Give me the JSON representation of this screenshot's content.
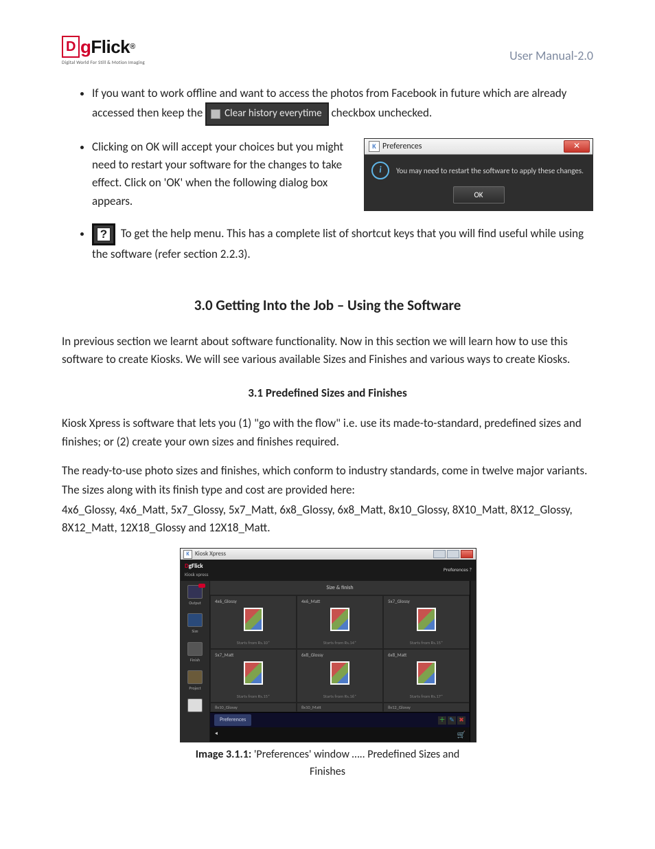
{
  "header": {
    "logo_sub": "Digital World For Still & Motion Imaging",
    "doc_title": "User Manual-2.0"
  },
  "bullets": {
    "b1_pre": "If you want to work offline and want to access the photos from Facebook in future which are already accessed then keep the ",
    "b1_chip": "Clear history everytime",
    "b1_post": " checkbox unchecked.",
    "b2": "Clicking on OK will accept your choices but you might need to restart your software for the changes to take effect. Click on 'OK' when the following dialog box appears.",
    "b3": " To get the help menu. This has a complete list of shortcut keys that you will find useful while using the software (refer section 2.2.3)."
  },
  "dialog": {
    "title": "Preferences",
    "message": "You may need to restart the software to apply these changes.",
    "ok": "OK"
  },
  "section_title": "3.0 Getting Into the Job – Using the Software",
  "intro": "In previous section we learnt about software functionality. Now in this section we will learn how to use this software to create Kiosks. We will see various available Sizes and Finishes and various ways to create Kiosks.",
  "subsection_title": "3.1 Predefined Sizes and Finishes",
  "p1": "Kiosk Xpress is software that lets you (1) \"go with the flow\" i.e. use its made-to-standard, predefined sizes and finishes; or (2) create your own sizes and finishes required.",
  "p2": "The ready-to-use photo sizes and finishes, which conform to industry standards, come in twelve major variants.",
  "p3": "The sizes along with its finish type and cost are provided here:",
  "p4": "4x6_Glossy, 4x6_Matt, 5x7_Glossy, 5x7_Matt, 6x8_Glossy, 6x8_Matt, 8x10_Glossy, 8X10_Matt, 8X12_Glossy, 8X12_Matt, 12X18_Glossy and 12X18_Matt.",
  "sw": {
    "win_title": "Kiosk Xpress",
    "brand_sub": "Kiosk xpress",
    "top_right": "Preferences  ?",
    "board_title": "Size & finish",
    "side": [
      "Output",
      "Size",
      "Finish",
      "Project",
      ""
    ],
    "cells": [
      {
        "name": "4x6_Glossy",
        "price": "Starts from Rs.10*"
      },
      {
        "name": "4x6_Matt",
        "price": "Starts from Rs.14*"
      },
      {
        "name": "5x7_Glossy",
        "price": "Starts from Rs.15*"
      },
      {
        "name": "5x7_Matt",
        "price": "Starts from Rs.15*"
      },
      {
        "name": "6x8_Glossy",
        "price": "Starts from Rs.16*"
      },
      {
        "name": "6x8_Matt",
        "price": "Starts from Rs.17*"
      }
    ],
    "below": [
      "8x10_Glossy",
      "8x10_Matt",
      "8x12_Glossy"
    ],
    "pref_btn": "Preferences"
  },
  "caption_bold": "Image 3.1.1:",
  "caption_rest": " 'Preferences' window ….. Predefined Sizes and Finishes"
}
